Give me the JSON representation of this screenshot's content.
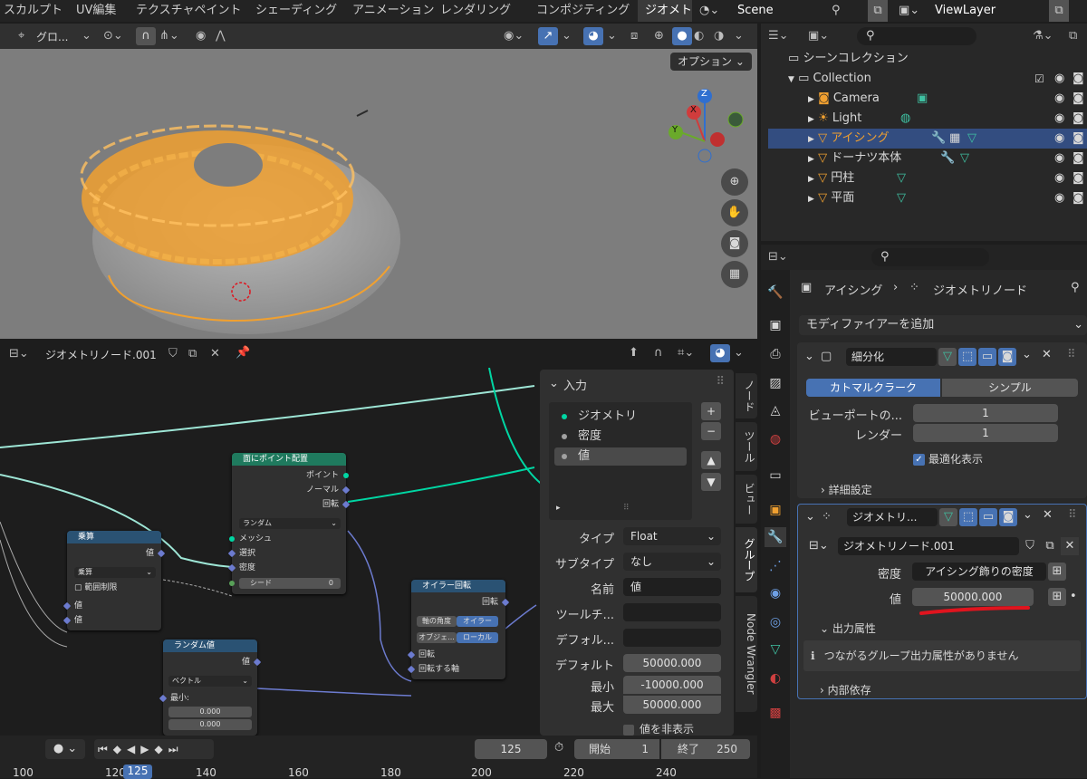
{
  "workspaces": [
    "スカルプト",
    "UV編集",
    "テクスチャペイント",
    "シェーディング",
    "アニメーション",
    "レンダリング",
    "コンポジティング",
    "ジオメト"
  ],
  "scene": {
    "name": "Scene",
    "view_layer": "ViewLayer"
  },
  "viewport": {
    "transform_label": "グロ...",
    "options_label": "オプション"
  },
  "gizmo": {
    "z": "Z",
    "x": "X",
    "y": "Y"
  },
  "node_editor": {
    "tree_name": "ジオメトリノード.001",
    "nodes": {
      "distribute": {
        "title": "面にポイント配置",
        "out_points": "ポイント",
        "out_normal": "ノーマル",
        "out_rotation": "回転",
        "mode": "ランダム",
        "in_mesh": "メッシュ",
        "in_selection": "選択",
        "in_density": "密度",
        "seed_label": "シード",
        "seed_value": "0"
      },
      "multiply": {
        "title": "乗算",
        "out_value": "値",
        "op": "乗算",
        "clamp": "範囲制限",
        "in_a": "値",
        "in_b": "値"
      },
      "euler": {
        "title": "オイラー回転",
        "out_rotation": "回転",
        "axis_angle": "軸の角度",
        "euler": "オイラー",
        "object": "オブジェ...",
        "local": "ローカル",
        "in_rotation": "回転",
        "in_axis": "回転する軸"
      },
      "random": {
        "title": "ランダム値",
        "out_value": "値",
        "type": "ベクトル",
        "min_label": "最小:",
        "min_x": "0.000",
        "min_y": "0.000"
      }
    },
    "sidebar_tabs": [
      "ノード",
      "ツール",
      "ビュー",
      "グループ",
      "Node Wrangler"
    ],
    "panel": {
      "title": "入力",
      "sockets": [
        "ジオメトリ",
        "密度",
        "値"
      ],
      "type_label": "タイプ",
      "type_value": "Float",
      "subtype_label": "サブタイプ",
      "subtype_value": "なし",
      "name_label": "名前",
      "name_value": "値",
      "tooltip_label": "ツールチ...",
      "default_attr_label": "デフォル...",
      "default_label": "デフォルト",
      "default_value": "50000.000",
      "min_label": "最小",
      "min_value": "-10000.000",
      "max_label": "最大",
      "max_value": "50000.000",
      "hide_value": "値を非表示"
    }
  },
  "timeline": {
    "current_frame": "125",
    "start_label": "開始",
    "start": "1",
    "end_label": "終了",
    "end": "250",
    "ticks": [
      "100",
      "120",
      "125",
      "140",
      "160",
      "180",
      "200",
      "220",
      "240"
    ]
  },
  "outliner": {
    "scene_collection": "シーンコレクション",
    "items": [
      {
        "name": "Collection",
        "color": "#d8d8d8"
      },
      {
        "name": "Camera",
        "color": "#d8d8d8"
      },
      {
        "name": "Light",
        "color": "#d8d8d8"
      },
      {
        "name": "アイシング",
        "color": "#f0a030"
      },
      {
        "name": "ドーナツ本体",
        "color": "#d8d8d8"
      },
      {
        "name": "円柱",
        "color": "#d8d8d8"
      },
      {
        "name": "平面",
        "color": "#d8d8d8"
      }
    ]
  },
  "properties": {
    "breadcrumb_object": "アイシング",
    "breadcrumb_modifier": "ジオメトリノード",
    "add_modifier": "モディファイアーを追加",
    "subsurf": {
      "name": "細分化",
      "catmull": "カトマルクラーク",
      "simple": "シンプル",
      "viewport_label": "ビューポートの...",
      "viewport_value": "1",
      "render_label": "レンダー",
      "render_value": "1",
      "optimal": "最適化表示",
      "advanced": "詳細設定"
    },
    "geonodes": {
      "name": "ジオメトリ...",
      "tree": "ジオメトリノード.001",
      "density_label": "密度",
      "density_value": "アイシング飾りの密度",
      "value_label": "値",
      "value_value": "50000.000",
      "output_attrs": "出力属性",
      "no_outputs": "つながるグループ出力属性がありません",
      "internal": "内部依存"
    }
  },
  "colors": {
    "accent": "#4772b3",
    "selected": "#f0a030",
    "geometry_socket": "#00d6a3",
    "annotation": "#e0141e"
  }
}
